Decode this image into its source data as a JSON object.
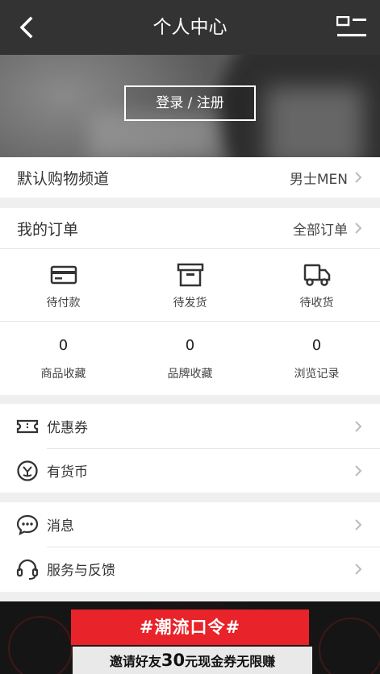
{
  "header": {
    "title": "个人中心"
  },
  "banner": {
    "login_label": "登录 / 注册"
  },
  "channel": {
    "label": "默认购物频道",
    "value": "男士MEN"
  },
  "orders": {
    "title": "我的订单",
    "all_label": "全部订单",
    "statuses": [
      {
        "label": "待付款",
        "icon": "card-icon"
      },
      {
        "label": "待发货",
        "icon": "box-icon"
      },
      {
        "label": "待收货",
        "icon": "truck-icon"
      }
    ]
  },
  "stats": [
    {
      "count": "0",
      "label": "商品收藏"
    },
    {
      "count": "0",
      "label": "品牌收藏"
    },
    {
      "count": "0",
      "label": "浏览记录"
    }
  ],
  "wallet": [
    {
      "label": "优惠券",
      "icon": "coupon-icon"
    },
    {
      "label": "有货币",
      "icon": "coin-icon"
    }
  ],
  "service": [
    {
      "label": "消息",
      "icon": "message-icon"
    },
    {
      "label": "服务与反馈",
      "icon": "headset-icon"
    }
  ],
  "promo": {
    "tag": "#潮流口令#",
    "line_prefix": "邀请好友",
    "line_amount": "30",
    "line_suffix": "元现金券无限赚"
  },
  "colors": {
    "header_bg": "#333333",
    "promo_red": "#e8232a"
  }
}
